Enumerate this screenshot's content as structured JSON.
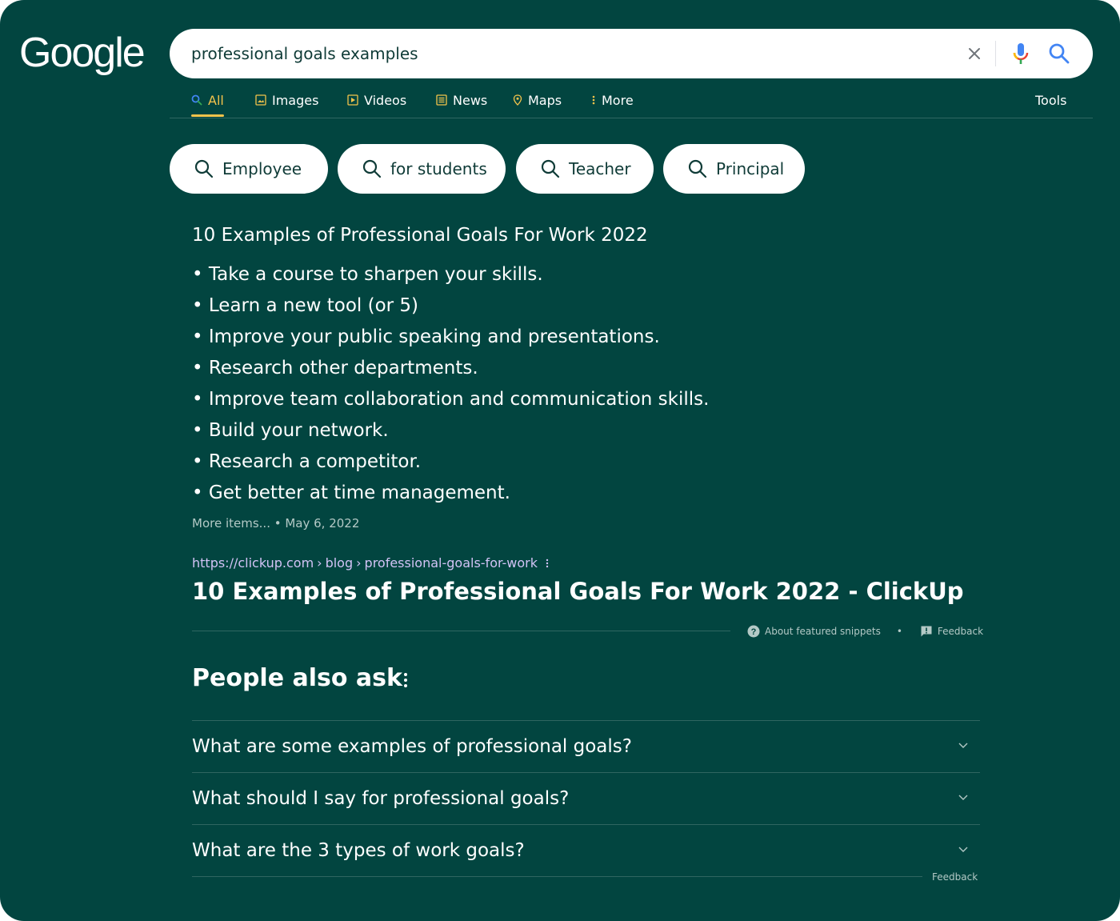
{
  "logo_text": "Google",
  "search": {
    "query": "professional goals examples"
  },
  "tabs": [
    {
      "label": "All",
      "icon": "search-icon",
      "active": true
    },
    {
      "label": "Images",
      "icon": "image-icon"
    },
    {
      "label": "Videos",
      "icon": "video-icon"
    },
    {
      "label": "News",
      "icon": "news-icon"
    },
    {
      "label": "Maps",
      "icon": "map-pin-icon"
    },
    {
      "label": "More",
      "icon": "more-vertical-icon"
    }
  ],
  "tools_label": "Tools",
  "chips": [
    {
      "label": "Employee"
    },
    {
      "label": "for students"
    },
    {
      "label": "Teacher"
    },
    {
      "label": "Principal"
    }
  ],
  "snippet": {
    "title": "10 Examples of Professional Goals For Work 2022",
    "items": [
      "• Take a course to sharpen your skills.",
      "• Learn a new tool (or 5)",
      "• Improve your public speaking and presentations.",
      "• Research other departments.",
      "• Improve team collaboration and communication skills.",
      "• Build your network.",
      "• Research a competitor.",
      "• Get better at time management."
    ],
    "more_items": "More items... • May 6, 2022",
    "breadcrumb": {
      "site": "https://clickup.com",
      "path1": "blog",
      "path2": "professional-goals-for-work"
    },
    "result_title": "10 Examples of Professional Goals For Work 2022 - ClickUp",
    "about_label": "About featured snippets",
    "feedback_label": "Feedback"
  },
  "paa": {
    "title": "People also ask",
    "questions": [
      "What are some examples of professional goals?",
      "What should I say for professional goals?",
      "What are the 3 types of work goals?"
    ],
    "feedback_label": "Feedback"
  },
  "colors": {
    "background": "#024540",
    "active_tab": "#f3c34b",
    "link_breadcrumb": "#d3c3f6",
    "muted_text": "#b4c9c6"
  }
}
